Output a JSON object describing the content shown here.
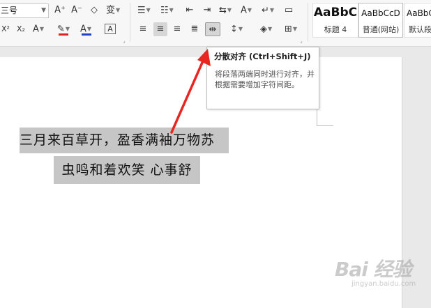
{
  "toolbar": {
    "font_size": "三号",
    "row1_font": [
      "A⁺",
      "A⁻",
      "◇",
      "变"
    ],
    "row2_font": [
      "X²",
      "X₂",
      "A",
      "✎",
      "A",
      "A"
    ],
    "colors": {
      "highlight_underline": "#e02020",
      "font_color_underline": "#1a44c8"
    },
    "paragraph_icons_row1": [
      "☰",
      "☷",
      "⇤",
      "⇥",
      "⇆",
      "✕",
      "A",
      "↵",
      "▭",
      "▥"
    ],
    "paragraph_icons_row2": [
      "≡",
      "≡",
      "≡",
      "≣",
      "⇹",
      "↕",
      "◈",
      "⊞"
    ]
  },
  "styles": [
    {
      "sample": "AaBbC",
      "name": "标题 4"
    },
    {
      "sample": "AaBbCcD",
      "name": "普通(网站)"
    },
    {
      "sample": "AaBbC",
      "name": "默认段"
    }
  ],
  "tooltip": {
    "title": "分散对齐 (Ctrl+Shift+J)",
    "description": "将段落两端同时进行对齐，并根据需要增加字符间距。"
  },
  "document": {
    "line1": "三月来百草开，盈香满袖万物苏",
    "line2": "虫鸣和着欢笑 心事舒"
  },
  "annotation": {
    "arrow_color": "#e8251f"
  },
  "watermark": {
    "logo": "Bai 经验",
    "url": "jingyan.baidu.com"
  }
}
